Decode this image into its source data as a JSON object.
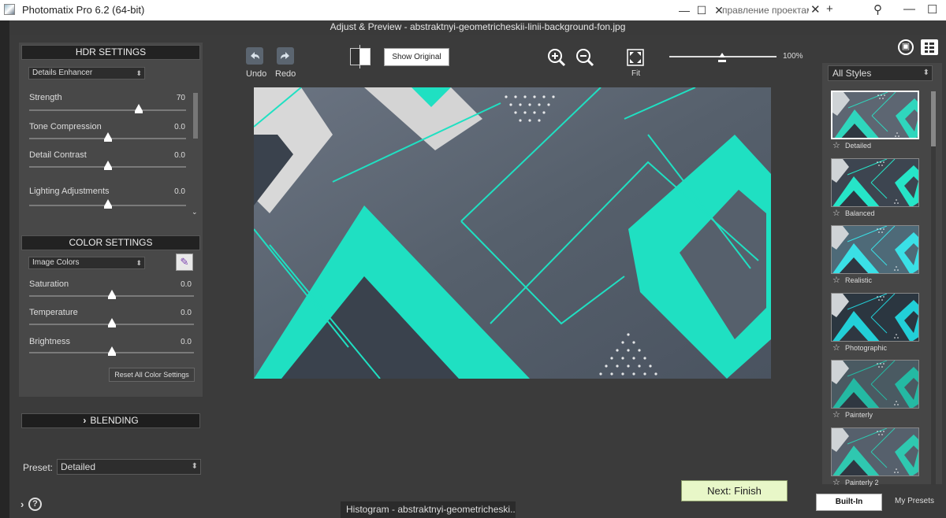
{
  "window": {
    "title": "Photomatix Pro 6.2 (64-bit)",
    "subtitle": "Adjust & Preview - abstraktnyi-geometricheskii-linii-background-fon.jpg",
    "bg_tab": "правление проектам"
  },
  "hdr": {
    "header": "HDR SETTINGS",
    "method": "Details Enhancer",
    "sliders": [
      {
        "label": "Strength",
        "value": "70",
        "level": 0.7
      },
      {
        "label": "Tone Compression",
        "value": "0.0",
        "level": 0.5
      },
      {
        "label": "Detail Contrast",
        "value": "0.0",
        "level": 0.5
      },
      {
        "label": "Lighting Adjustments",
        "value": "0.0",
        "level": 0.5
      }
    ]
  },
  "color": {
    "header": "COLOR SETTINGS",
    "mode": "Image Colors",
    "sliders": [
      {
        "label": "Saturation",
        "value": "0.0",
        "level": 0.5
      },
      {
        "label": "Temperature",
        "value": "0.0",
        "level": 0.5
      },
      {
        "label": "Brightness",
        "value": "0.0",
        "level": 0.5
      }
    ],
    "reset_label": "Reset All Color Settings"
  },
  "blending": {
    "header": "BLENDING",
    "chevron": "›"
  },
  "preset": {
    "label": "Preset:",
    "value": "Detailed"
  },
  "help": "?",
  "toolbar": {
    "undo": "Undo",
    "redo": "Redo",
    "show_original": "Show Original",
    "fit": "Fit",
    "zoom": "100%",
    "zoom_level": 0.5
  },
  "styles": {
    "dropdown": "All Styles",
    "items": [
      "Detailed",
      "Balanced",
      "Realistic",
      "Photographic",
      "Painterly",
      "Painterly 2"
    ]
  },
  "tabs": {
    "builtin": "Built-In",
    "mypresets": "My Presets"
  },
  "next_label": "Next: Finish",
  "histogram_label": "Histogram - abstraktnyi-geometricheski...",
  "colors": {
    "accent": "#1fe0c2",
    "next_bg": "#e8f7c8"
  }
}
